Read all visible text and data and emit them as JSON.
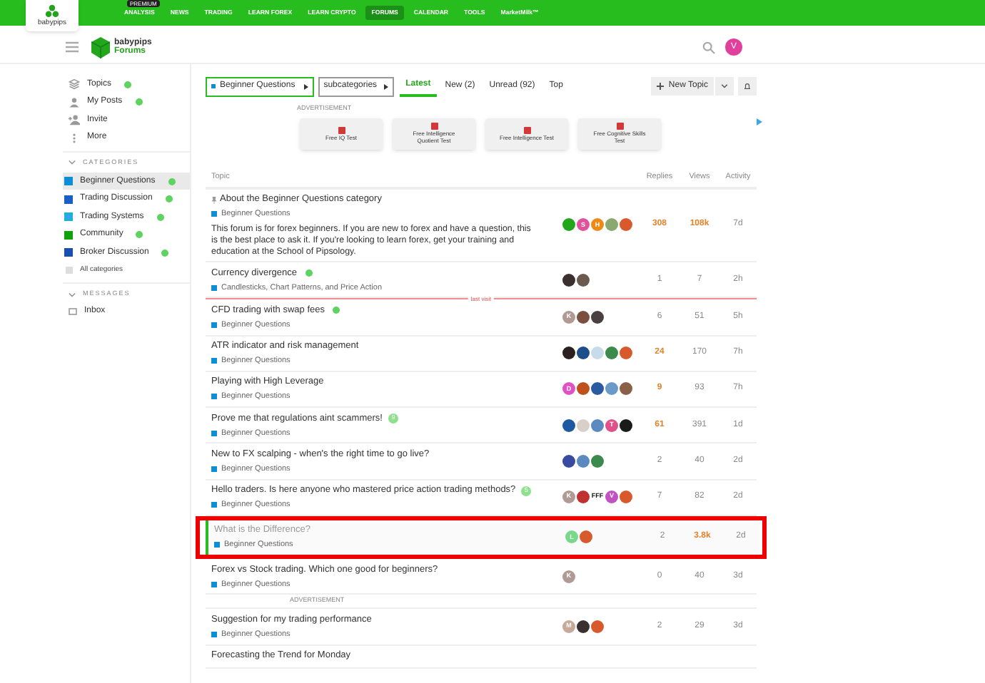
{
  "top_nav": {
    "logo": "babypips",
    "items": [
      {
        "label": "ANALYSIS",
        "badge": "PREMIUM",
        "selected": false
      },
      {
        "label": "NEWS",
        "selected": false
      },
      {
        "label": "TRADING",
        "selected": false
      },
      {
        "label": "LEARN FOREX",
        "selected": false
      },
      {
        "label": "LEARN CRYPTO",
        "selected": false
      },
      {
        "label": "FORUMS",
        "selected": true
      },
      {
        "label": "CALENDAR",
        "selected": false
      },
      {
        "label": "TOOLS",
        "selected": false
      },
      {
        "label": "MarketMilk™",
        "selected": false
      }
    ]
  },
  "header": {
    "brand": "babypips",
    "subtitle": "Forums",
    "avatar": "V"
  },
  "sidebar": {
    "items": [
      {
        "label": "Topics",
        "new": true
      },
      {
        "label": "My Posts",
        "new": true
      },
      {
        "label": "Invite",
        "new": false
      },
      {
        "label": "More",
        "new": false
      }
    ],
    "categories_heading": "CATEGORIES",
    "categories": [
      {
        "label": "Beginner Questions",
        "color": "#0e8fd5",
        "new": true,
        "selected": true
      },
      {
        "label": "Trading Discussion",
        "color": "#1c5fc4",
        "new": true,
        "selected": false
      },
      {
        "label": "Trading Systems",
        "color": "#25aae2",
        "new": true,
        "selected": false
      },
      {
        "label": "Community",
        "color": "#12a10e",
        "new": true,
        "selected": false
      },
      {
        "label": "Broker Discussion",
        "color": "#1b4fad",
        "new": true,
        "selected": false
      }
    ],
    "all_categories": "All categories",
    "messages_heading": "MESSAGES",
    "messages": [
      {
        "label": "Inbox"
      }
    ]
  },
  "filters": {
    "category": "Beginner Questions",
    "subcategories": "subcategories",
    "tabs": [
      {
        "label": "Latest",
        "selected": true
      },
      {
        "label": "New (2)",
        "selected": false
      },
      {
        "label": "Unread (92)",
        "selected": false
      },
      {
        "label": "Top",
        "selected": false
      }
    ],
    "new_topic": "New Topic"
  },
  "ad": {
    "label": "ADVERTISEMENT",
    "items": [
      "Free IQ Test",
      "Free Intelligence Quotient Test",
      "Free Intelligence Test",
      "Free Cognitive Skills Test"
    ]
  },
  "table": {
    "columns": [
      "Topic",
      "Replies",
      "Views",
      "Activity"
    ],
    "rows": [
      {
        "kind": "topic",
        "title": "About the Beginner Questions category",
        "pinned": true,
        "category": "Beginner Questions",
        "excerpt": "This forum is for forex beginners. If you are new to forex and have a question, this is the best place to ask it. If you're looking to learn forex, get your training and education at the School of Pipsology.",
        "avatars": [
          {
            "color": "#22a61c"
          },
          {
            "color": "#e0529c",
            "letter": "S"
          },
          {
            "color": "#ec8a14",
            "letter": "H"
          },
          {
            "color": "#8aa870"
          },
          {
            "color": "#d85a2c"
          }
        ],
        "replies": "308",
        "views": "108k",
        "activity": "7d",
        "hot": true,
        "hot_views": true
      },
      {
        "kind": "topic",
        "title": "Currency divergence",
        "new_dot": true,
        "category": "Candlesticks, Chart Patterns, and Price Action",
        "avatars": [
          {
            "color": "#3a3030"
          },
          {
            "color": "#6a5a50"
          }
        ],
        "replies": "1",
        "views": "7",
        "activity": "2h"
      },
      {
        "kind": "divider",
        "label": "last visit"
      },
      {
        "kind": "topic",
        "title": "CFD trading with swap fees",
        "new_dot": true,
        "category": "Beginner Questions",
        "avatars": [
          {
            "color": "#b09a94",
            "letter": "K"
          },
          {
            "color": "#7a5040"
          },
          {
            "color": "#4a4040"
          }
        ],
        "replies": "6",
        "views": "51",
        "activity": "5h"
      },
      {
        "kind": "topic",
        "title": "ATR indicator and risk management",
        "category": "Beginner Questions",
        "avatars": [
          {
            "color": "#2a2020"
          },
          {
            "color": "#1d4e8a"
          },
          {
            "color": "#c8dbe8"
          },
          {
            "color": "#3c8a4c"
          },
          {
            "color": "#d85a2c"
          }
        ],
        "replies": "24",
        "views": "170",
        "activity": "7h",
        "hot": true
      },
      {
        "kind": "topic",
        "title": "Playing with High Leverage",
        "category": "Beginner Questions",
        "avatars": [
          {
            "color": "#e052c4",
            "letter": "D"
          },
          {
            "color": "#c0501c"
          },
          {
            "color": "#2a5aa0"
          },
          {
            "color": "#6a9ac8"
          },
          {
            "color": "#8a6048"
          }
        ],
        "replies": "9",
        "views": "93",
        "activity": "7h",
        "hot": true
      },
      {
        "kind": "topic",
        "title": "Prove me that regulations aint scammers!",
        "badge": "9",
        "category": "Beginner Questions",
        "avatars": [
          {
            "color": "#1d5aa0"
          },
          {
            "color": "#d8d0c8"
          },
          {
            "color": "#5a8ac0"
          },
          {
            "color": "#e0528a",
            "letter": "T"
          },
          {
            "color": "#1a1a1a"
          }
        ],
        "replies": "61",
        "views": "391",
        "activity": "1d",
        "hot": true
      },
      {
        "kind": "topic",
        "title": "New to FX scalping - when's the right time to go live?",
        "category": "Beginner Questions",
        "avatars": [
          {
            "color": "#3a4aa0"
          },
          {
            "color": "#5a8ac0"
          },
          {
            "color": "#3c8a4c"
          }
        ],
        "replies": "2",
        "views": "40",
        "activity": "2d"
      },
      {
        "kind": "topic",
        "title": "Hello traders. Is here anyone who mastered price action trading methods?",
        "badge": "5",
        "category": "Beginner Questions",
        "avatars": [
          {
            "color": "#b09a94",
            "letter": "K"
          },
          {
            "color": "#c03030"
          },
          {
            "color": "#ffffff",
            "letter": "FFF"
          },
          {
            "color": "#c052c4",
            "letter": "V"
          },
          {
            "color": "#d85a2c"
          }
        ],
        "replies": "7",
        "views": "82",
        "activity": "2d"
      },
      {
        "kind": "topic",
        "title": "What is the Difference?",
        "category": "Beginner Questions",
        "avatars": [
          {
            "color": "#7ad88a",
            "letter": "L"
          },
          {
            "color": "#d85a2c"
          }
        ],
        "replies": "2",
        "views": "3.8k",
        "activity": "2d",
        "hot_views": true,
        "visited": true,
        "highlighted": true
      },
      {
        "kind": "topic",
        "title": "Forex vs Stock trading. Which one good for beginners?",
        "category": "Beginner Questions",
        "avatars": [
          {
            "color": "#b09a94",
            "letter": "K"
          }
        ],
        "replies": "0",
        "views": "40",
        "activity": "3d"
      },
      {
        "kind": "ad",
        "label": "ADVERTISEMENT"
      },
      {
        "kind": "topic",
        "title": "Suggestion for my trading performance",
        "category": "Beginner Questions",
        "avatars": [
          {
            "color": "#c8a898",
            "letter": "M"
          },
          {
            "color": "#3a3030"
          },
          {
            "color": "#d85a2c"
          }
        ],
        "replies": "2",
        "views": "29",
        "activity": "3d"
      },
      {
        "kind": "topic",
        "title": "Forecasting the Trend for Monday",
        "avatars": []
      }
    ]
  }
}
